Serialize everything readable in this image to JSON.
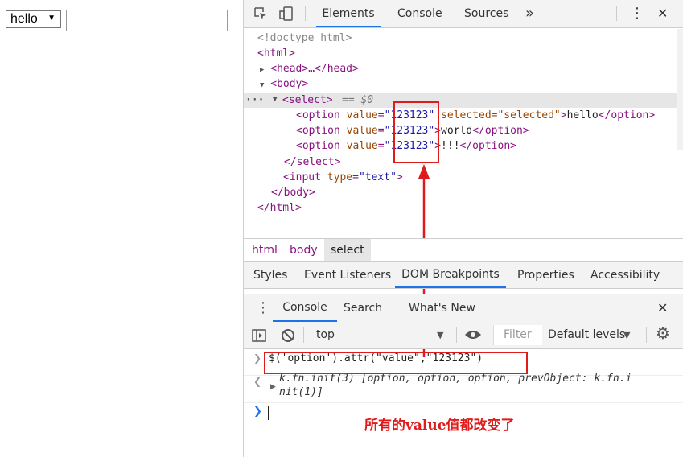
{
  "page": {
    "select_value": "hello",
    "input_value": ""
  },
  "devtools": {
    "tabs": [
      "Elements",
      "Console",
      "Sources"
    ],
    "more_tabs": "»",
    "menu_glyph": "⋮",
    "close_glyph": "✕",
    "dom": {
      "doctype": "<!doctype html>",
      "html_open": "<html>",
      "head": "<head>…</head>",
      "body_open": "<body>",
      "select_open": "<select>",
      "selected_marker": "== $0",
      "option1_pre": "<option value=\"",
      "option_value": "123123",
      "option1_post_attr": " selected=\"selected\"",
      "option1_text": "hello",
      "option2_text": "world",
      "option3_text": "!!!",
      "option_close": "</option>",
      "select_close": "</select>",
      "input_line": "<input type=\"text\">",
      "body_close": "</body>",
      "html_close": "</html>"
    },
    "breadcrumbs": [
      "html",
      "body",
      "select"
    ],
    "sub_tabs": [
      "Styles",
      "Event Listeners",
      "DOM Breakpoints",
      "Properties",
      "Accessibility"
    ],
    "drawer_tabs": [
      "Console",
      "Search",
      "What's New"
    ],
    "console_toolbar": {
      "context": "top",
      "filter_placeholder": "Filter",
      "levels": "Default levels"
    },
    "console": {
      "command": "$('option').attr(\"value\",\"123123\")",
      "result_line1": "k.fn.init(3) [option, option, option, prevObject: k.fn.i",
      "result_line2": "nit(1)]"
    },
    "annotation": "所有的value值都改变了",
    "colors": {
      "accent": "#1a73e8",
      "highlight": "#e01b1b",
      "tag": "#881280",
      "attr": "#994500",
      "value": "#1a1aa6"
    }
  }
}
